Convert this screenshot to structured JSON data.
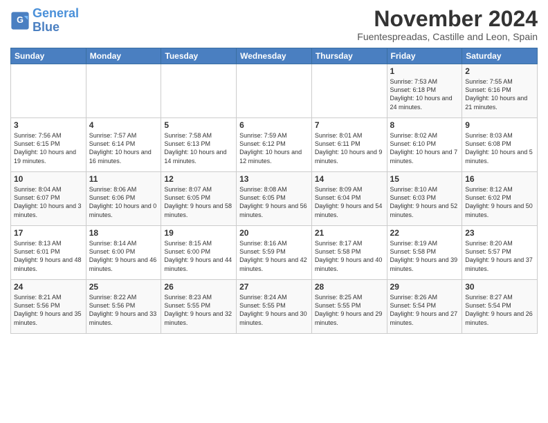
{
  "header": {
    "logo_line1": "General",
    "logo_line2": "Blue",
    "title": "November 2024",
    "location": "Fuentespreadas, Castille and Leon, Spain"
  },
  "days_of_week": [
    "Sunday",
    "Monday",
    "Tuesday",
    "Wednesday",
    "Thursday",
    "Friday",
    "Saturday"
  ],
  "weeks": [
    [
      {
        "num": "",
        "info": ""
      },
      {
        "num": "",
        "info": ""
      },
      {
        "num": "",
        "info": ""
      },
      {
        "num": "",
        "info": ""
      },
      {
        "num": "",
        "info": ""
      },
      {
        "num": "1",
        "info": "Sunrise: 7:53 AM\nSunset: 6:18 PM\nDaylight: 10 hours and 24 minutes."
      },
      {
        "num": "2",
        "info": "Sunrise: 7:55 AM\nSunset: 6:16 PM\nDaylight: 10 hours and 21 minutes."
      }
    ],
    [
      {
        "num": "3",
        "info": "Sunrise: 7:56 AM\nSunset: 6:15 PM\nDaylight: 10 hours and 19 minutes."
      },
      {
        "num": "4",
        "info": "Sunrise: 7:57 AM\nSunset: 6:14 PM\nDaylight: 10 hours and 16 minutes."
      },
      {
        "num": "5",
        "info": "Sunrise: 7:58 AM\nSunset: 6:13 PM\nDaylight: 10 hours and 14 minutes."
      },
      {
        "num": "6",
        "info": "Sunrise: 7:59 AM\nSunset: 6:12 PM\nDaylight: 10 hours and 12 minutes."
      },
      {
        "num": "7",
        "info": "Sunrise: 8:01 AM\nSunset: 6:11 PM\nDaylight: 10 hours and 9 minutes."
      },
      {
        "num": "8",
        "info": "Sunrise: 8:02 AM\nSunset: 6:10 PM\nDaylight: 10 hours and 7 minutes."
      },
      {
        "num": "9",
        "info": "Sunrise: 8:03 AM\nSunset: 6:08 PM\nDaylight: 10 hours and 5 minutes."
      }
    ],
    [
      {
        "num": "10",
        "info": "Sunrise: 8:04 AM\nSunset: 6:07 PM\nDaylight: 10 hours and 3 minutes."
      },
      {
        "num": "11",
        "info": "Sunrise: 8:06 AM\nSunset: 6:06 PM\nDaylight: 10 hours and 0 minutes."
      },
      {
        "num": "12",
        "info": "Sunrise: 8:07 AM\nSunset: 6:05 PM\nDaylight: 9 hours and 58 minutes."
      },
      {
        "num": "13",
        "info": "Sunrise: 8:08 AM\nSunset: 6:05 PM\nDaylight: 9 hours and 56 minutes."
      },
      {
        "num": "14",
        "info": "Sunrise: 8:09 AM\nSunset: 6:04 PM\nDaylight: 9 hours and 54 minutes."
      },
      {
        "num": "15",
        "info": "Sunrise: 8:10 AM\nSunset: 6:03 PM\nDaylight: 9 hours and 52 minutes."
      },
      {
        "num": "16",
        "info": "Sunrise: 8:12 AM\nSunset: 6:02 PM\nDaylight: 9 hours and 50 minutes."
      }
    ],
    [
      {
        "num": "17",
        "info": "Sunrise: 8:13 AM\nSunset: 6:01 PM\nDaylight: 9 hours and 48 minutes."
      },
      {
        "num": "18",
        "info": "Sunrise: 8:14 AM\nSunset: 6:00 PM\nDaylight: 9 hours and 46 minutes."
      },
      {
        "num": "19",
        "info": "Sunrise: 8:15 AM\nSunset: 6:00 PM\nDaylight: 9 hours and 44 minutes."
      },
      {
        "num": "20",
        "info": "Sunrise: 8:16 AM\nSunset: 5:59 PM\nDaylight: 9 hours and 42 minutes."
      },
      {
        "num": "21",
        "info": "Sunrise: 8:17 AM\nSunset: 5:58 PM\nDaylight: 9 hours and 40 minutes."
      },
      {
        "num": "22",
        "info": "Sunrise: 8:19 AM\nSunset: 5:58 PM\nDaylight: 9 hours and 39 minutes."
      },
      {
        "num": "23",
        "info": "Sunrise: 8:20 AM\nSunset: 5:57 PM\nDaylight: 9 hours and 37 minutes."
      }
    ],
    [
      {
        "num": "24",
        "info": "Sunrise: 8:21 AM\nSunset: 5:56 PM\nDaylight: 9 hours and 35 minutes."
      },
      {
        "num": "25",
        "info": "Sunrise: 8:22 AM\nSunset: 5:56 PM\nDaylight: 9 hours and 33 minutes."
      },
      {
        "num": "26",
        "info": "Sunrise: 8:23 AM\nSunset: 5:55 PM\nDaylight: 9 hours and 32 minutes."
      },
      {
        "num": "27",
        "info": "Sunrise: 8:24 AM\nSunset: 5:55 PM\nDaylight: 9 hours and 30 minutes."
      },
      {
        "num": "28",
        "info": "Sunrise: 8:25 AM\nSunset: 5:55 PM\nDaylight: 9 hours and 29 minutes."
      },
      {
        "num": "29",
        "info": "Sunrise: 8:26 AM\nSunset: 5:54 PM\nDaylight: 9 hours and 27 minutes."
      },
      {
        "num": "30",
        "info": "Sunrise: 8:27 AM\nSunset: 5:54 PM\nDaylight: 9 hours and 26 minutes."
      }
    ]
  ]
}
